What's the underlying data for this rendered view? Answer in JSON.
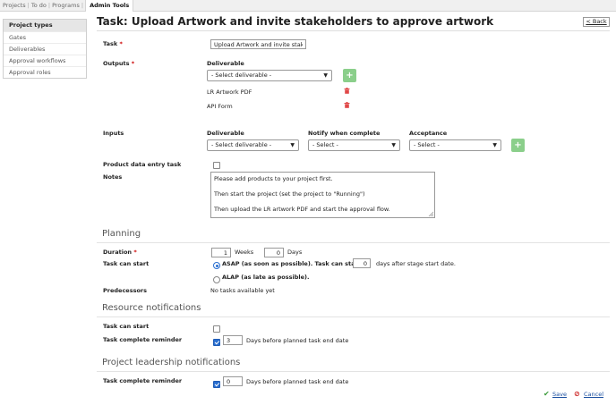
{
  "topnav": {
    "items": [
      "Projects",
      "To do",
      "Programs"
    ],
    "active": "Admin Tools"
  },
  "sidebar": {
    "items": [
      {
        "label": "Project types",
        "active": true
      },
      {
        "label": "Gates",
        "active": false
      },
      {
        "label": "Deliverables",
        "active": false
      },
      {
        "label": "Approval workflows",
        "active": false
      },
      {
        "label": "Approval roles",
        "active": false
      }
    ]
  },
  "header": {
    "title": "Task: Upload Artwork and invite stakeholders to approve artwork",
    "back_label": "< Back"
  },
  "form": {
    "task": {
      "label": "Task",
      "required_mark": "*",
      "value": "Upload Artwork and invite stakeholders to approve artwork"
    },
    "outputs": {
      "label": "Outputs",
      "required_mark": "*",
      "deliverable_header": "Deliverable",
      "select_placeholder": "- Select deliverable -",
      "items": [
        "LR Artwork PDF",
        "API Form"
      ]
    },
    "inputs": {
      "label": "Inputs",
      "headers": {
        "deliverable": "Deliverable",
        "notify": "Notify when complete",
        "acceptance": "Acceptance"
      },
      "deliverable_placeholder": "- Select deliverable -",
      "notify_placeholder": "- Select -",
      "acceptance_placeholder": "- Select -"
    },
    "product_data_entry_task": {
      "label": "Product data entry task",
      "checked": false
    },
    "notes": {
      "label": "Notes",
      "lines": [
        "Please add products to your project first.",
        "Then start the project (set the project to \"Running\")",
        "Then upload the LR artwork PDF and start the approval flow."
      ]
    }
  },
  "planning": {
    "title": "Planning",
    "duration": {
      "label": "Duration",
      "required_mark": "*",
      "weeks": "1",
      "weeks_unit": "Weeks",
      "days": "0",
      "days_unit": "Days"
    },
    "task_can_start": {
      "label": "Task can start",
      "asap_label": "ASAP (as soon as possible). Task can start",
      "asap_days": "0",
      "asap_suffix": "days after stage start date.",
      "alap_label": "ALAP (as late as possible).",
      "selected": "asap"
    },
    "predecessors": {
      "label": "Predecessors",
      "value": "No tasks available yet"
    }
  },
  "resource_notifications": {
    "title": "Resource notifications",
    "task_can_start": {
      "label": "Task can start",
      "checked": false
    },
    "task_complete_reminder": {
      "label": "Task complete reminder",
      "checked": true,
      "days": "3",
      "suffix": "Days before planned task end date"
    }
  },
  "leadership_notifications": {
    "title": "Project leadership notifications",
    "task_complete_reminder": {
      "label": "Task complete reminder",
      "checked": true,
      "days": "0",
      "suffix": "Days before planned task end date"
    }
  },
  "actions": {
    "save_label": "Save",
    "cancel_label": "Cancel"
  },
  "colors": {
    "accent_green": "#8bcf8b",
    "delete_red": "#e04848",
    "link_blue": "#1a4fa0",
    "save_check": "#3a9a3a",
    "cancel_red": "#cc2222"
  }
}
